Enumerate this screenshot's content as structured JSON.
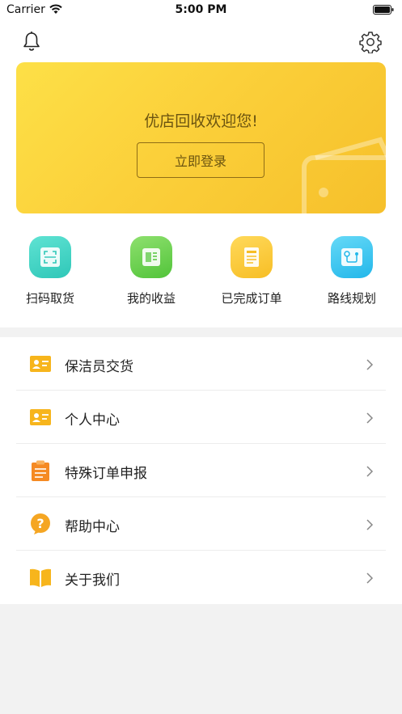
{
  "status_bar": {
    "carrier": "Carrier",
    "time": "5:00 PM"
  },
  "banner": {
    "welcome": "优店回收欢迎您!",
    "login_label": "立即登录"
  },
  "quick_actions": [
    {
      "label": "扫码取货",
      "icon": "scan-icon",
      "color": "#3fd6c6"
    },
    {
      "label": "我的收益",
      "icon": "earnings-icon",
      "color": "#6fd455"
    },
    {
      "label": "已完成订单",
      "icon": "completed-orders-icon",
      "color": "#fbc93a"
    },
    {
      "label": "路线规划",
      "icon": "route-icon",
      "color": "#3cc8f0"
    }
  ],
  "menu": [
    {
      "label": "保洁员交货",
      "icon": "id-card-icon"
    },
    {
      "label": "个人中心",
      "icon": "id-card-icon"
    },
    {
      "label": "特殊订单申报",
      "icon": "clipboard-icon"
    },
    {
      "label": "帮助中心",
      "icon": "help-icon"
    },
    {
      "label": "关于我们",
      "icon": "book-icon"
    }
  ],
  "colors": {
    "banner_start": "#fde047",
    "banner_end": "#f6c02b",
    "menu_icon_orange": "#f5a623"
  }
}
